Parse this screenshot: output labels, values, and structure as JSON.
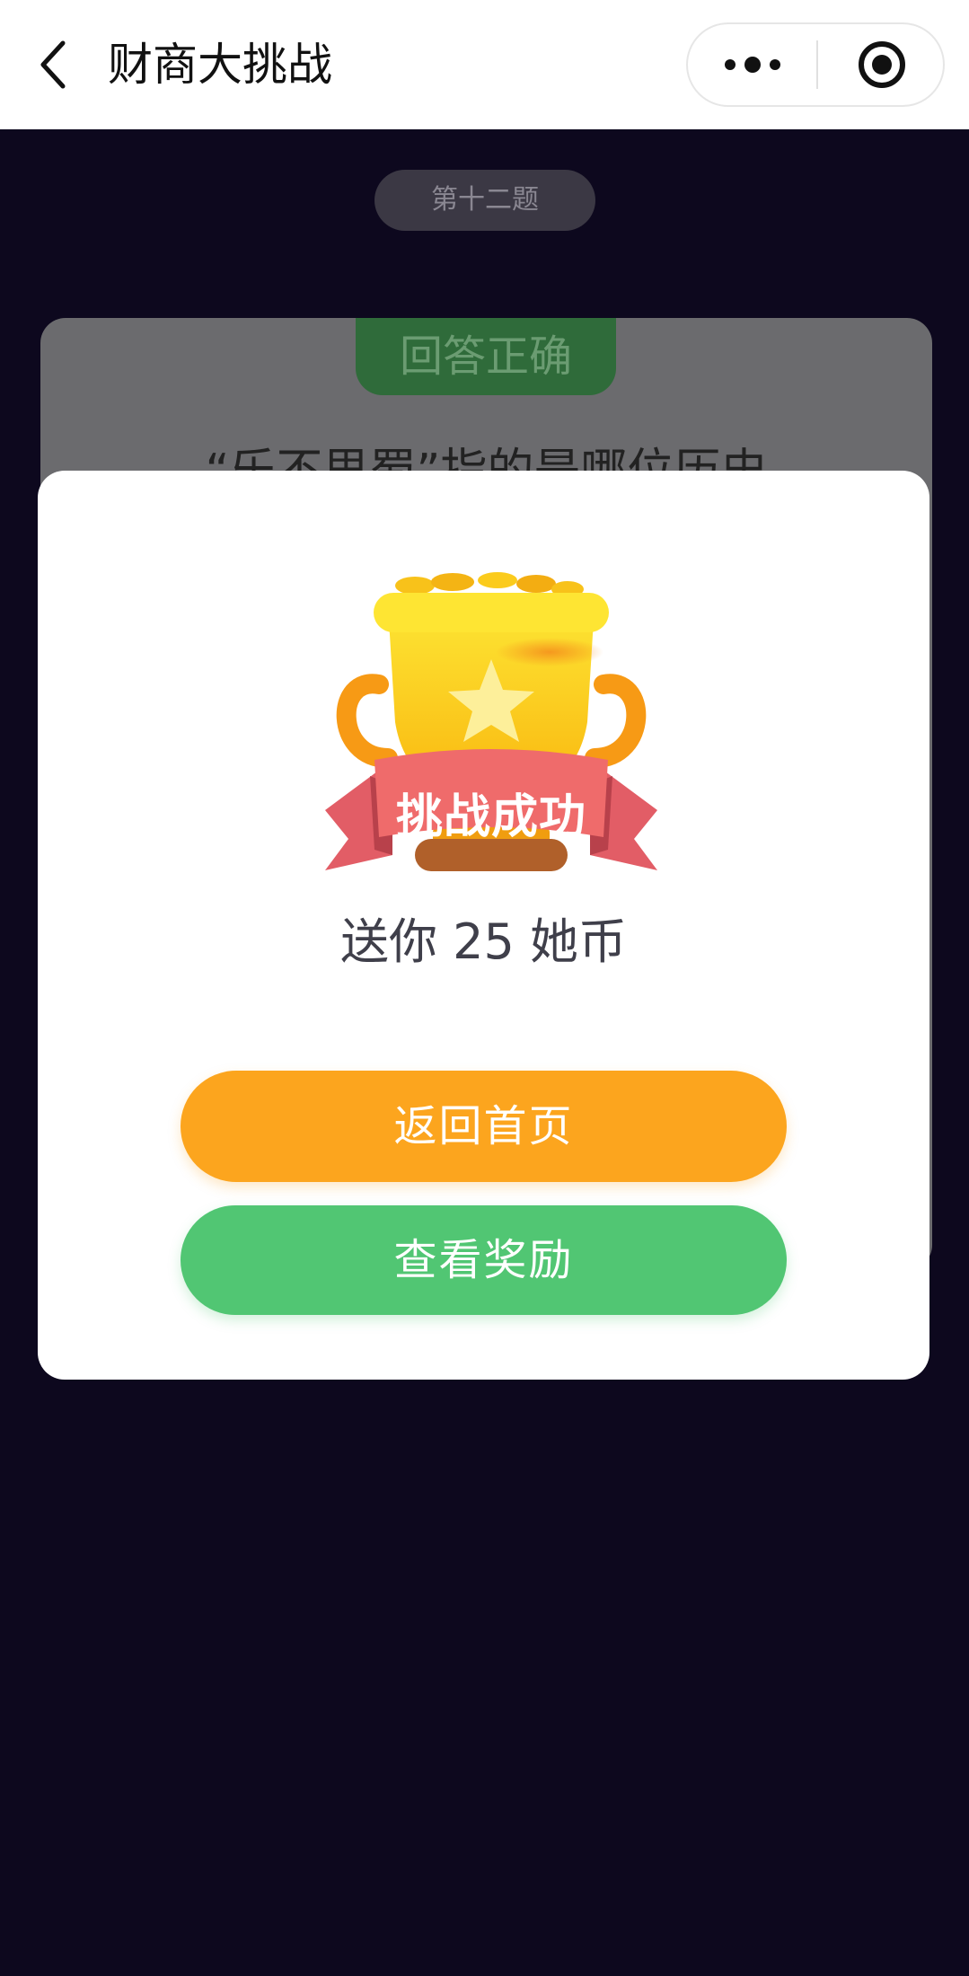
{
  "navbar": {
    "title": "财商大挑战",
    "back_icon": "chevron-left-icon",
    "more_icon": "more-dots-icon",
    "close_icon": "target-circle-icon"
  },
  "background": {
    "question_number": "第十二题",
    "answer_status": "回答正确",
    "question_partial": "“乐不思蜀”指的是哪位历史"
  },
  "modal": {
    "badge_text": "挑战成功",
    "reward_text": "送你 25 她币",
    "home_button": "返回首页",
    "reward_button": "查看奖励"
  },
  "colors": {
    "page_bg": "#0d081e",
    "orange": "#fca51e",
    "green": "#51c673",
    "ribbon": "#ef6b6b",
    "trophy_gold": "#fdd418"
  }
}
